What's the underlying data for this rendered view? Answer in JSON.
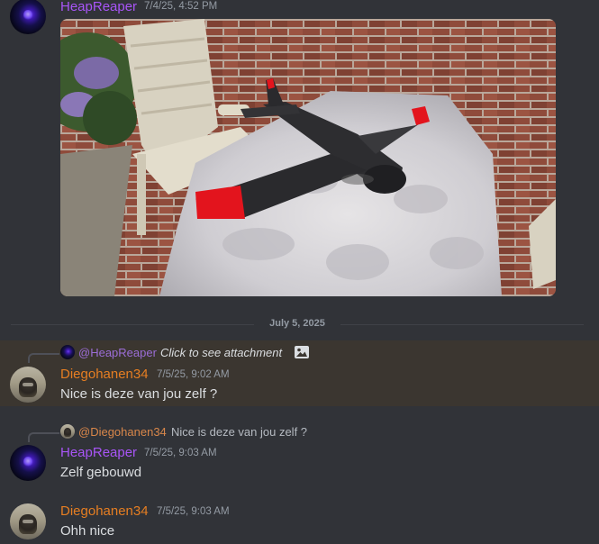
{
  "colors": {
    "background": "#313338",
    "highlight_background": "#3b3630",
    "username_purple": "#a855f7",
    "username_orange": "#e67e22",
    "timestamp": "#949ba4",
    "message_text": "#dbdee1"
  },
  "messages": [
    {
      "author": "HeapReaper",
      "timestamp": "7/4/25, 4:52 PM",
      "avatar_icon": "hooded-figure-avatar",
      "attachment": {
        "description_icon": "rc-airplane-photo"
      }
    },
    {
      "author": "Diegohanen34",
      "timestamp": "7/5/25, 9:02 AM",
      "avatar_icon": "dog-avatar",
      "text": "Nice is deze van jou zelf ?",
      "reply": {
        "mention": "@HeapReaper",
        "text": "Click to see attachment",
        "icon": "image-icon"
      },
      "highlighted": true
    },
    {
      "author": "HeapReaper",
      "timestamp": "7/5/25, 9:03 AM",
      "avatar_icon": "hooded-figure-avatar",
      "text": "Zelf gebouwd",
      "reply": {
        "mention": "@Diegohanen34",
        "text": "Nice is deze van jou zelf ?"
      }
    },
    {
      "author": "Diegohanen34",
      "timestamp": "7/5/25, 9:03 AM",
      "avatar_icon": "dog-avatar",
      "text": "Ohh nice"
    }
  ],
  "date_divider": "July 5, 2025"
}
